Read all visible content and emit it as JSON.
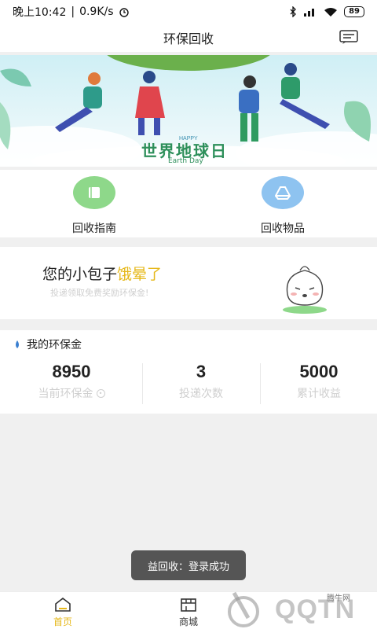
{
  "status_bar": {
    "time": "晚上10:42",
    "separator": "|",
    "speed": "0.9K/s",
    "battery": "89"
  },
  "header": {
    "title": "环保回收"
  },
  "banner": {
    "happy_text": "HAPPY",
    "title": "世界地球日",
    "subtitle": "Earth Day"
  },
  "quick_actions": [
    {
      "label": "回收指南",
      "icon": "book-icon",
      "color": "#8ed88a"
    },
    {
      "label": "回收物品",
      "icon": "drive-triangle-icon",
      "color": "#8ec3f0"
    }
  ],
  "promo": {
    "title_prefix": "您的小包子",
    "title_highlight": "饿晕了",
    "subtitle": "投递领取免费奖励环保金!"
  },
  "fund": {
    "header": "我的环保金",
    "stats": [
      {
        "value": "8950",
        "label": "当前环保金"
      },
      {
        "value": "3",
        "label": "投递次数"
      },
      {
        "value": "5000",
        "label": "累计收益"
      }
    ]
  },
  "toast": {
    "message": "益回收：登录成功"
  },
  "bottom_nav": {
    "items": [
      {
        "label": "首页",
        "icon": "home-icon",
        "active": true
      },
      {
        "label": "商城",
        "icon": "store-icon",
        "active": false
      }
    ]
  },
  "watermark": {
    "text": "QQTN",
    "caption": "腾牛网"
  },
  "colors": {
    "accent": "#e6b81a",
    "green": "#8ed88a",
    "blue": "#8ec3f0"
  }
}
